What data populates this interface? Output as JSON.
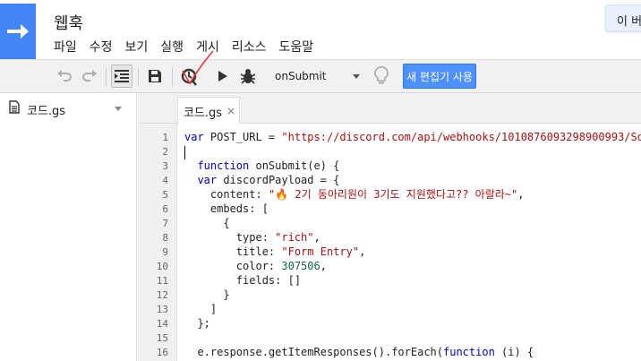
{
  "app": {
    "title": "웹훅",
    "menu": [
      "파일",
      "수정",
      "보기",
      "실행",
      "게시",
      "리소스",
      "도움말"
    ],
    "notice_text": "이 버"
  },
  "toolbar": {
    "undo_icon": "undo-icon",
    "redo_icon": "redo-icon",
    "function_select": "onSubmit",
    "new_editor_label": "새 편집기 사용"
  },
  "file_panel": {
    "files": [
      {
        "name": "코드.gs"
      }
    ]
  },
  "editor": {
    "tab_label": "코드.gs",
    "tab_close": "×",
    "line_numbers": [
      "1",
      "2",
      "3",
      "4",
      "5",
      "6",
      "7",
      "8",
      "9",
      "10",
      "11",
      "12",
      "13",
      "14",
      "15",
      "16"
    ],
    "code": {
      "l1_kw": "var",
      "l1_mid": " POST_URL = ",
      "l1_str": "\"https://discord.com/api/webhooks/1010876093298900993/So",
      "l3_kw": "function",
      "l3_rest": " onSubmit(e) {",
      "l4_kw": "var",
      "l4_rest": " discordPayload = {",
      "l5_a": "content: ",
      "l5_q": "\"",
      "l5_emoji": "🔥",
      "l5_str": " 2기 동아리원이 3기도 지원했다고?? 아랄라~\"",
      "l5_end": ",",
      "l6": "embeds: [",
      "l7": "{",
      "l8_a": "type: ",
      "l8_str": "\"rich\"",
      "l8_end": ",",
      "l9_a": "title: ",
      "l9_str": "\"Form Entry\"",
      "l9_end": ",",
      "l10_a": "color: ",
      "l10_num": "307506",
      "l10_end": ",",
      "l11": "fields: []",
      "l12": "}",
      "l13": "]",
      "l14": "};",
      "l16_a": "e.response.getItemResponses().forEach(",
      "l16_kw": "function",
      "l16_b": " (i) {"
    }
  }
}
